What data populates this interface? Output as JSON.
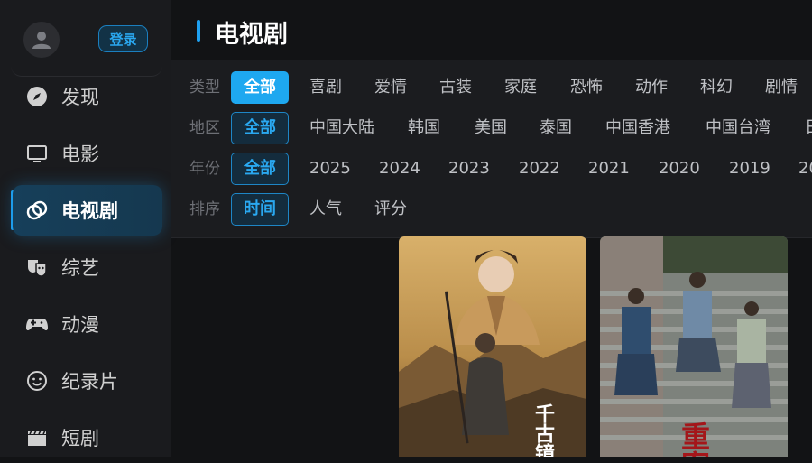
{
  "sidebar": {
    "login_label": "登录",
    "items": [
      {
        "label": "发现",
        "icon": "compass-icon"
      },
      {
        "label": "电影",
        "icon": "monitor-icon"
      },
      {
        "label": "电视剧",
        "icon": "tv-rings-icon"
      },
      {
        "label": "综艺",
        "icon": "masks-icon"
      },
      {
        "label": "动漫",
        "icon": "gamepad-icon"
      },
      {
        "label": "纪录片",
        "icon": "smiley-icon"
      },
      {
        "label": "短剧",
        "icon": "clapper-icon"
      }
    ],
    "active_index": 2
  },
  "header": {
    "title": "电视剧"
  },
  "filters": {
    "type": {
      "label": "类型",
      "options": [
        "全部",
        "喜剧",
        "爱情",
        "古装",
        "家庭",
        "恐怖",
        "动作",
        "科幻",
        "剧情"
      ]
    },
    "region": {
      "label": "地区",
      "options": [
        "全部",
        "中国大陆",
        "韩国",
        "美国",
        "泰国",
        "中国香港",
        "中国台湾",
        "日"
      ]
    },
    "year": {
      "label": "年份",
      "options": [
        "全部",
        "2025",
        "2024",
        "2023",
        "2022",
        "2021",
        "2020",
        "2019",
        "20"
      ]
    },
    "sort": {
      "label": "排序",
      "options": [
        "时间",
        "人气",
        "评分"
      ]
    }
  },
  "posters": [
    {
      "title_text": "千古镜鉴",
      "colors": {
        "sky": "#caa25c",
        "ground": "#6b4a2a"
      }
    },
    {
      "title_text": "重案",
      "colors": {
        "sky": "#8a8f8a",
        "ground": "#5c5f5c"
      }
    }
  ],
  "colors": {
    "accent": "#1ea8f0",
    "background": "#121315",
    "sidebar": "#1a1b1e"
  }
}
